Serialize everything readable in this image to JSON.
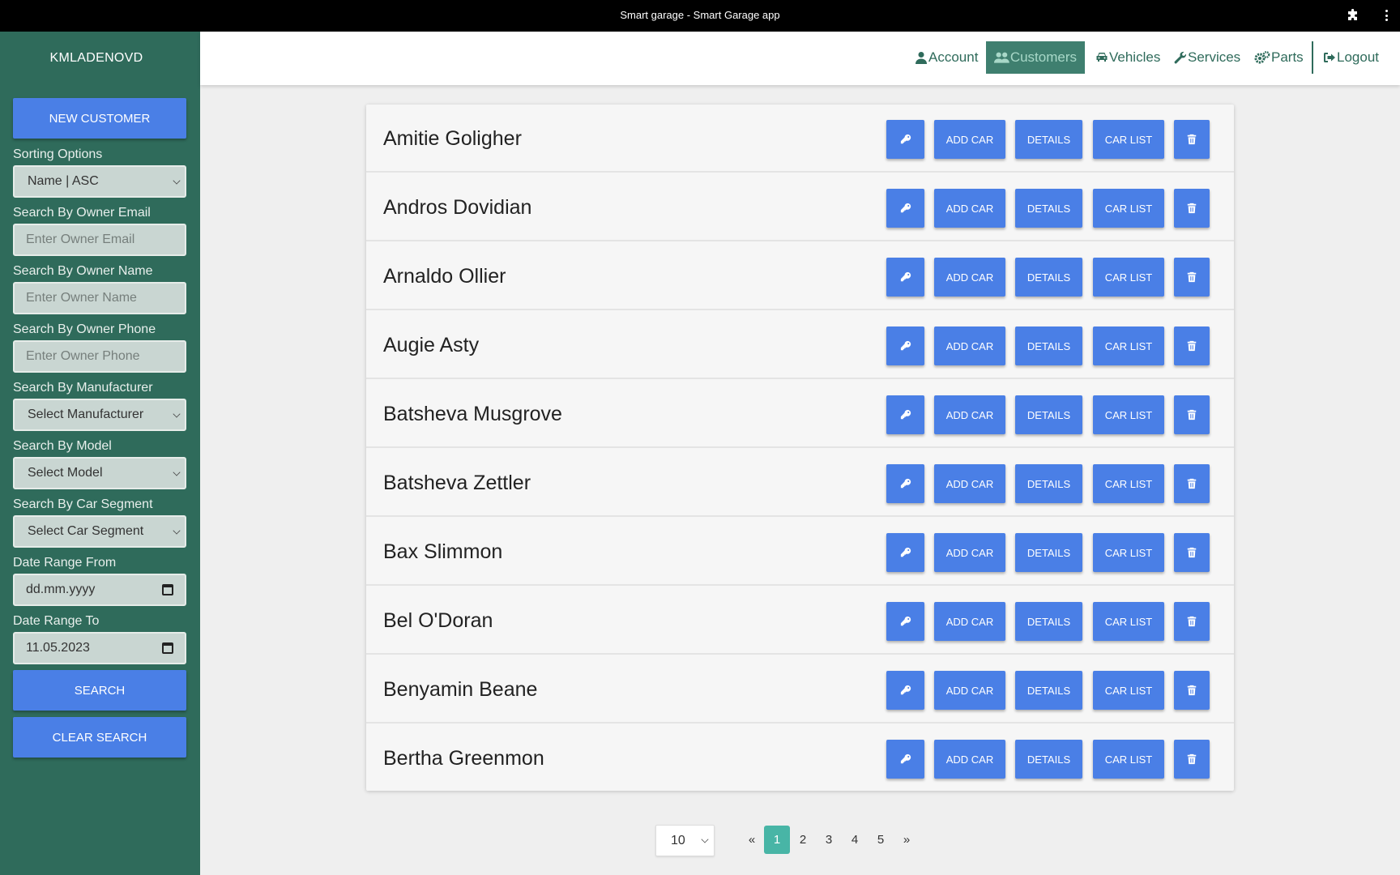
{
  "window": {
    "title": "Smart garage - Smart Garage app",
    "extension_icon": "puzzle-icon",
    "menu_icon": "kebab-menu-icon"
  },
  "sidebar": {
    "username": "KMLADENOVD",
    "new_customer_label": "NEW CUSTOMER",
    "sorting": {
      "label": "Sorting Options",
      "value": "Name | ASC"
    },
    "owner_email": {
      "label": "Search By Owner Email",
      "placeholder": "Enter Owner Email"
    },
    "owner_name": {
      "label": "Search By Owner Name",
      "placeholder": "Enter Owner Name"
    },
    "owner_phone": {
      "label": "Search By Owner Phone",
      "placeholder": "Enter Owner Phone"
    },
    "manufacturer": {
      "label": "Search By Manufacturer",
      "value": "Select Manufacturer"
    },
    "model": {
      "label": "Search By Model",
      "value": "Select Model"
    },
    "segment": {
      "label": "Search By Car Segment",
      "value": "Select Car Segment"
    },
    "date_from": {
      "label": "Date Range From",
      "value": "dd.mm.yyyy"
    },
    "date_to": {
      "label": "Date Range To",
      "value": "11.05.2023"
    },
    "search_label": "SEARCH",
    "clear_label": "CLEAR SEARCH"
  },
  "nav": {
    "account": "Account",
    "customers": "Customers",
    "vehicles": "Vehicles",
    "services": "Services",
    "parts": "Parts",
    "logout": "Logout",
    "active": "Customers"
  },
  "row_buttons": {
    "add_car": "ADD CAR",
    "details": "DETAILS",
    "car_list": "CAR LIST"
  },
  "customers": [
    "Amitie Goligher",
    "Andros Dovidian",
    "Arnaldo Ollier",
    "Augie Asty",
    "Batsheva Musgrove",
    "Batsheva Zettler",
    "Bax Slimmon",
    "Bel O'Doran",
    "Benyamin Beane",
    "Bertha Greenmon"
  ],
  "pagination": {
    "page_size": "10",
    "prev": "«",
    "next": "»",
    "pages": [
      "1",
      "2",
      "3",
      "4",
      "5"
    ],
    "current": "1"
  },
  "colors": {
    "sidebar": "#2f6b5b",
    "button": "#4a7fe6",
    "active_page": "#48b5a6"
  }
}
